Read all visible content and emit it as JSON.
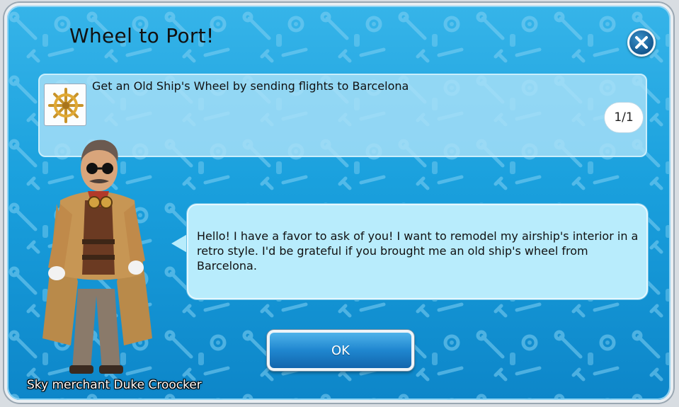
{
  "dialog": {
    "title": "Wheel to Port!",
    "close_icon": "close-icon",
    "colors": {
      "background": "#1aa0dd",
      "panel": "#b8ecfc",
      "button": "#1f86cf"
    }
  },
  "quest": {
    "icon": "ship-wheel-icon",
    "description": "Get an Old Ship's Wheel by sending flights to Barcelona",
    "progress": "1/1"
  },
  "speech": {
    "text": "Hello! I have a favor to ask of you! I want to remodel my airship's interior in a retro style. I'd be grateful if you brought me an old ship's wheel from Barcelona."
  },
  "ok_button": {
    "label": "OK"
  },
  "character": {
    "name": "Sky merchant Duke Croocker"
  }
}
